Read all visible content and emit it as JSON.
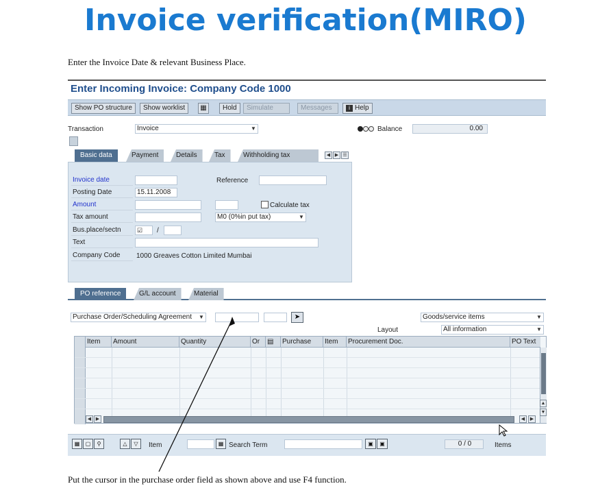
{
  "slide": {
    "title": "Invoice verification(MIRO)",
    "instruction_top": "Enter the Invoice Date & relevant Business Place.",
    "instruction_bottom": "Put the cursor in the purchase order field as shown above and use F4 function."
  },
  "window": {
    "title": "Enter Incoming Invoice: Company Code 1000"
  },
  "toolbar": {
    "show_po_structure": "Show PO structure",
    "show_worklist": "Show worklist",
    "hold": "Hold",
    "simulate": "Simulate",
    "messages": "Messages",
    "help": "Help"
  },
  "header": {
    "transaction_label": "Transaction",
    "transaction_value": "Invoice",
    "balance_label": "Balance",
    "balance_value": "0.00"
  },
  "tabs": [
    "Basic data",
    "Payment",
    "Details",
    "Tax",
    "Withholding tax"
  ],
  "basic": {
    "invoice_date_label": "Invoice date",
    "invoice_date_value": "",
    "reference_label": "Reference",
    "reference_value": "",
    "posting_date_label": "Posting Date",
    "posting_date_value": "15.11.2008",
    "amount_label": "Amount",
    "amount_value": "",
    "calculate_tax_label": "Calculate tax",
    "tax_amount_label": "Tax amount",
    "tax_code_value": "M0 (0%in put tax)",
    "bus_place_label": "Bus.place/sectn",
    "bus_place_sep": "/",
    "text_label": "Text",
    "company_code_label": "Company Code",
    "company_code_value": "1000 Greaves Cotton Limited Mumbai"
  },
  "lower_tabs": [
    "PO reference",
    "G/L account",
    "Material"
  ],
  "po": {
    "reference_type": "Purchase Order/Scheduling Agreement",
    "goods_service": "Goods/service items",
    "layout_label": "Layout",
    "layout_value": "All information"
  },
  "grid": {
    "columns": [
      "Item",
      "Amount",
      "Quantity",
      "Or",
      "",
      "Purchase",
      "Item",
      "Procurement Doc.",
      "PO Text"
    ]
  },
  "bottom": {
    "item_label": "Item",
    "search_term_label": "Search Term",
    "counter": "0 / 0",
    "items_label": "Items"
  }
}
